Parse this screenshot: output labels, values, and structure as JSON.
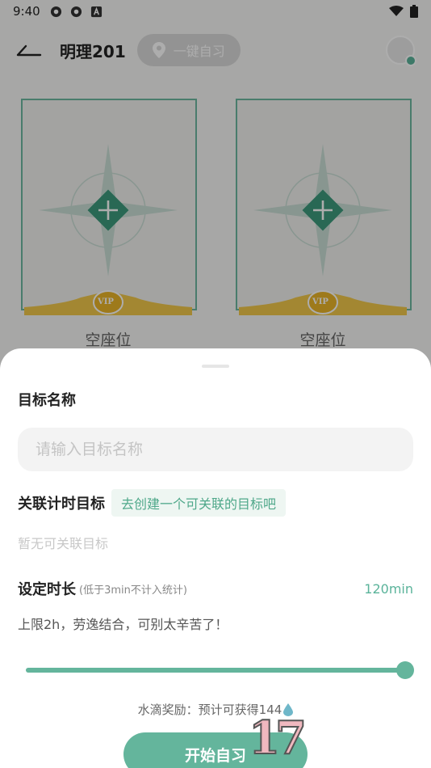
{
  "status_bar": {
    "time": "9:40"
  },
  "header": {
    "room_name": "明理201",
    "quick_study_label": "一键自习"
  },
  "seats": [
    {
      "label": "空座位",
      "badge": "VIP"
    },
    {
      "label": "空座位",
      "badge": "VIP"
    }
  ],
  "sheet": {
    "goal_name_label": "目标名称",
    "goal_name_placeholder": "请输入目标名称",
    "linked_goal_label": "关联计时目标",
    "create_goal_link": "去创建一个可关联的目标吧",
    "no_goal_text": "暂无可关联目标",
    "duration_label": "设定时长",
    "duration_note": "(低于3min不计入统计)",
    "duration_value": "120min",
    "duration_hint": "上限2h，劳逸结合，可别太辛苦了！",
    "slider_fraction": 1.0,
    "reward_text": "水滴奖励：预计可获得144",
    "start_button": "开始自习"
  },
  "overlay_number": "17",
  "colors": {
    "accent": "#64b59c",
    "link_bg": "#eef6f2"
  }
}
